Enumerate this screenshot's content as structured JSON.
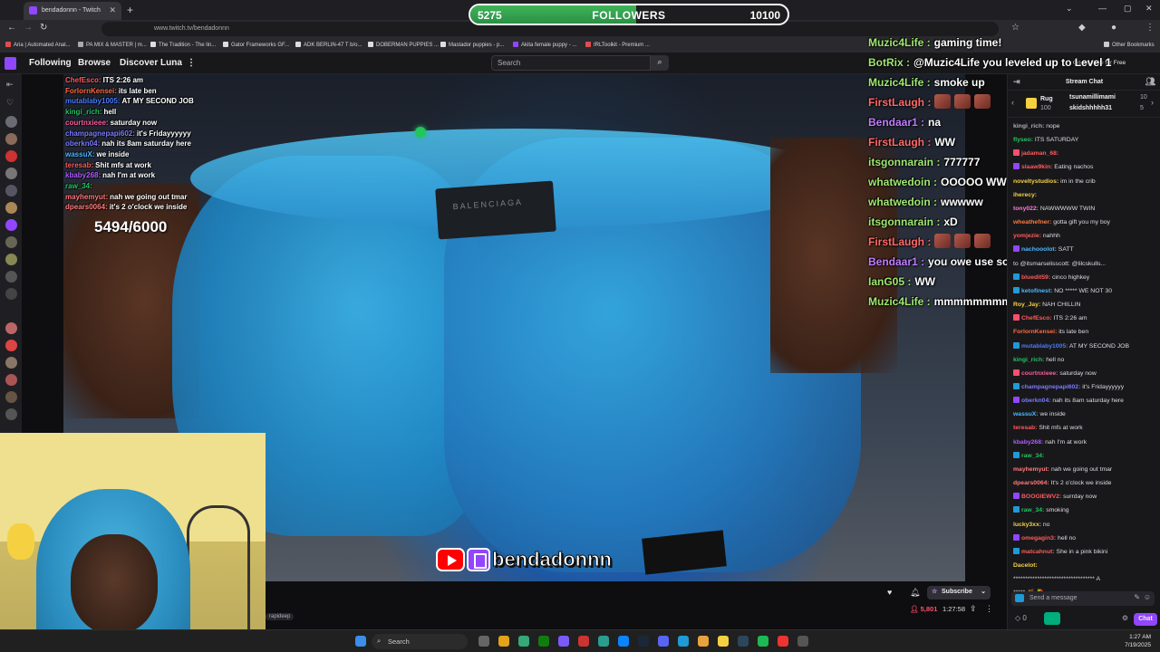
{
  "browser": {
    "tab_title": "bendadonnn - Twitch",
    "url": "www.twitch.tv/bendadonnn",
    "bookmarks": [
      "Aria | Automated Anal...",
      "PA MIX & MASTER | m...",
      "The Tradition - The lin...",
      "Gator Frameworks GF...",
      "ADK BERLIN-47 T b/o...",
      "DOBERMAN PUPPIES ...",
      "Mastador puppies - p...",
      "Akita female puppy - ...",
      "IRLToolkit - Premium ..."
    ],
    "other_bookmarks": "Other Bookmarks"
  },
  "twitch": {
    "nav": [
      "Following",
      "Browse",
      "Discover Luna"
    ],
    "search_placeholder": "Search",
    "go_ad_free": "Go Ad-Free for Free"
  },
  "followers_goal": {
    "current": "5275",
    "title": "FOLLOWERS",
    "goal": "10100",
    "progress": 0.522
  },
  "sub_goal_text": "5494/6000",
  "stream_handle": "bendadonnn",
  "video_label": "BALENCIAGA",
  "overlay_small_chat": [
    {
      "user": "ChefEsco:",
      "text": "ITS 2:26 am",
      "color": "#ff5a5a"
    },
    {
      "user": "ForlornKensei:",
      "text": "its late ben",
      "color": "#ff6a3d"
    },
    {
      "user": "mutablaby1005:",
      "text": "AT MY SECOND JOB",
      "color": "#4a7bff"
    },
    {
      "user": "kingi_rich:",
      "text": "hell",
      "color": "#22c55e"
    },
    {
      "user": "courtnxieee:",
      "text": "saturday now",
      "color": "#ff5a9e"
    },
    {
      "user": "champagnepapi602:",
      "text": "it's Fridayyyyyy",
      "color": "#7b7bff"
    },
    {
      "user": "oberkn04:",
      "text": "nah its 8am saturday here",
      "color": "#7b7bff"
    },
    {
      "user": "wassuX:",
      "text": "we inside",
      "color": "#4ab8ff"
    },
    {
      "user": "teresab:",
      "text": "Shit mfs at work",
      "color": "#ff5a5a"
    },
    {
      "user": "kbaby268:",
      "text": "nah I'm at work",
      "color": "#b05cff"
    },
    {
      "user": "raw_34:",
      "text": "",
      "color": "#22c55e"
    },
    {
      "user": "mayhemyut:",
      "text": "nah we going out tmar",
      "color": "#ff7a7a"
    },
    {
      "user": "dpears0064:",
      "text": "it's 2 o'clock we inside",
      "color": "#ff7a7a"
    }
  ],
  "overlay_big_chat": [
    {
      "user": "Muzic4Life :",
      "text": "gaming time!",
      "color": "#9fe870"
    },
    {
      "user": "BotRix :",
      "text": "@Muzic4Life you leveled up to Level 1",
      "color": "#9fe870"
    },
    {
      "user": "Muzic4Life :",
      "text": "smoke up",
      "color": "#9fe870"
    },
    {
      "user": "FirstLaugh :",
      "text": "",
      "color": "#ff6a6a"
    },
    {
      "user": "Bendaar1 :",
      "text": "na",
      "color": "#c07bff"
    },
    {
      "user": "FirstLaugh :",
      "text": "WW",
      "color": "#ff6a6a"
    },
    {
      "user": "itsgonnarain :",
      "text": "777777",
      "color": "#9fe870"
    },
    {
      "user": "whatwedoin :",
      "text": "OOOOO WW",
      "color": "#9fe870"
    },
    {
      "user": "whatwedoin :",
      "text": "wwwww",
      "color": "#9fe870"
    },
    {
      "user": "itsgonnarain :",
      "text": "xD",
      "color": "#9fe870"
    },
    {
      "user": "FirstLaugh :",
      "text": "",
      "color": "#ff6a6a"
    },
    {
      "user": "Bendaar1 :",
      "text": "you owe use so many eps",
      "color": "#c07bff"
    },
    {
      "user": "IanG05 :",
      "text": "WW",
      "color": "#9fe870"
    },
    {
      "user": "Muzic4Life :",
      "text": "mmmmmmmmmm",
      "color": "#9fe870"
    }
  ],
  "chat": {
    "header": "Stream Chat",
    "gifters": [
      "Rug",
      "100",
      "tsunamillimami",
      "10",
      "skidshhhhh31",
      "5"
    ],
    "messages": [
      {
        "user": "kingi_rich:",
        "text": "nope",
        "color": "#adadb8",
        "badge": ""
      },
      {
        "user": "flyseo:",
        "text": "ITS SATURDAY",
        "color": "#22c55e",
        "badge": ""
      },
      {
        "user": "jadaman_68:",
        "text": "",
        "color": "#ff5a5a",
        "badge": "#ff4e6c"
      },
      {
        "user": "slaaw9kin:",
        "text": "Eating nachos",
        "color": "#ff5a5a",
        "badge": "#9146ff"
      },
      {
        "user": "noveltystudios:",
        "text": "im in the crib",
        "color": "#f5d142",
        "badge": ""
      },
      {
        "user": "iherecy:",
        "text": "",
        "color": "#f5d142",
        "badge": ""
      },
      {
        "user": "tony022:",
        "text": "NAWWWWW TWIN",
        "color": "#ff7ad9",
        "badge": ""
      },
      {
        "user": "wheathefner:",
        "text": "gotta gift you my boy",
        "color": "#ff7a3d",
        "badge": ""
      },
      {
        "user": "yomjezie:",
        "text": "nahhh",
        "color": "#ff5a5a",
        "badge": ""
      },
      {
        "user": "nachooolot:",
        "text": "SATT",
        "color": "#4ab8ff",
        "badge": "#9146ff"
      },
      {
        "user": "",
        "text": "to @itsmarselisscott: @lilcskulls...",
        "color": "#adadb8",
        "badge": ""
      },
      {
        "user": "bluedit59:",
        "text": "cinco highkey",
        "color": "#ff5a5a",
        "badge": "#1f9ad6"
      },
      {
        "user": "ketofinest:",
        "text": "NO ***** WE NOT 30",
        "color": "#4ab8ff",
        "badge": "#1f9ad6"
      },
      {
        "user": "Roy_Jay:",
        "text": "NAH CHILLIN",
        "color": "#f5d142",
        "badge": ""
      },
      {
        "user": "ChefEsco:",
        "text": "ITS 2:26 am",
        "color": "#ff5a5a",
        "badge": "#ff4e6c"
      },
      {
        "user": "ForlornKensei:",
        "text": "its late ben",
        "color": "#ff6a3d",
        "badge": ""
      },
      {
        "user": "mutablaby1005:",
        "text": "AT MY SECOND JOB",
        "color": "#4a7bff",
        "badge": "#1f9ad6"
      },
      {
        "user": "kingi_rich:",
        "text": "hell no",
        "color": "#22c55e",
        "badge": ""
      },
      {
        "user": "courtnxieee:",
        "text": "saturday now",
        "color": "#ff5a9e",
        "badge": "#ff4e6c"
      },
      {
        "user": "champagnepapi602:",
        "text": "it's Fridayyyyyy",
        "color": "#7b7bff",
        "badge": "#1f9ad6"
      },
      {
        "user": "oberkn04:",
        "text": "nah its 8am saturday here",
        "color": "#7b7bff",
        "badge": "#9146ff"
      },
      {
        "user": "wassuX:",
        "text": "we inside",
        "color": "#4ab8ff",
        "badge": ""
      },
      {
        "user": "teresab:",
        "text": "Shit mfs at work",
        "color": "#ff5a5a",
        "badge": ""
      },
      {
        "user": "kbaby268:",
        "text": "nah I'm at work",
        "color": "#b05cff",
        "badge": ""
      },
      {
        "user": "raw_34:",
        "text": "",
        "color": "#22c55e",
        "badge": "#1f9ad6"
      },
      {
        "user": "mayhemyut:",
        "text": "nah we going out tmar",
        "color": "#ff7a7a",
        "badge": ""
      },
      {
        "user": "dpears0064:",
        "text": "It's 2 o'clock we inside",
        "color": "#ff7a7a",
        "badge": ""
      },
      {
        "user": "BOOGIEWV2:",
        "text": "surrday now",
        "color": "#ff5a5a",
        "badge": "#9146ff"
      },
      {
        "user": "raw_34:",
        "text": "smoking",
        "color": "#22c55e",
        "badge": "#1f9ad6"
      },
      {
        "user": "lucky3xx:",
        "text": "no",
        "color": "#f5d142",
        "badge": ""
      },
      {
        "user": "omegagin3:",
        "text": "hell no",
        "color": "#ff5a5a",
        "badge": "#9146ff"
      },
      {
        "user": "matcahnut:",
        "text": "She in a pink bikini",
        "color": "#ff5a5a",
        "badge": "#1f9ad6"
      },
      {
        "user": "Dacelot:",
        "text": "",
        "color": "#f5d142",
        "badge": ""
      },
      {
        "user": "",
        "text": "********************************** A",
        "color": "#adadb8",
        "badge": ""
      },
      {
        "user": "",
        "text": "***** 👏🏾 🍓",
        "color": "#adadb8",
        "badge": ""
      }
    ],
    "input_placeholder": "Send a message",
    "points": "0",
    "chat_button": "Chat"
  },
  "player": {
    "subscribe": "Subscribe",
    "viewers": "5,801",
    "uptime": "1:27:58",
    "tag": "rapideep"
  },
  "taskbar": {
    "search": "Search",
    "time": "1:27 AM",
    "date": "7/19/2025"
  }
}
